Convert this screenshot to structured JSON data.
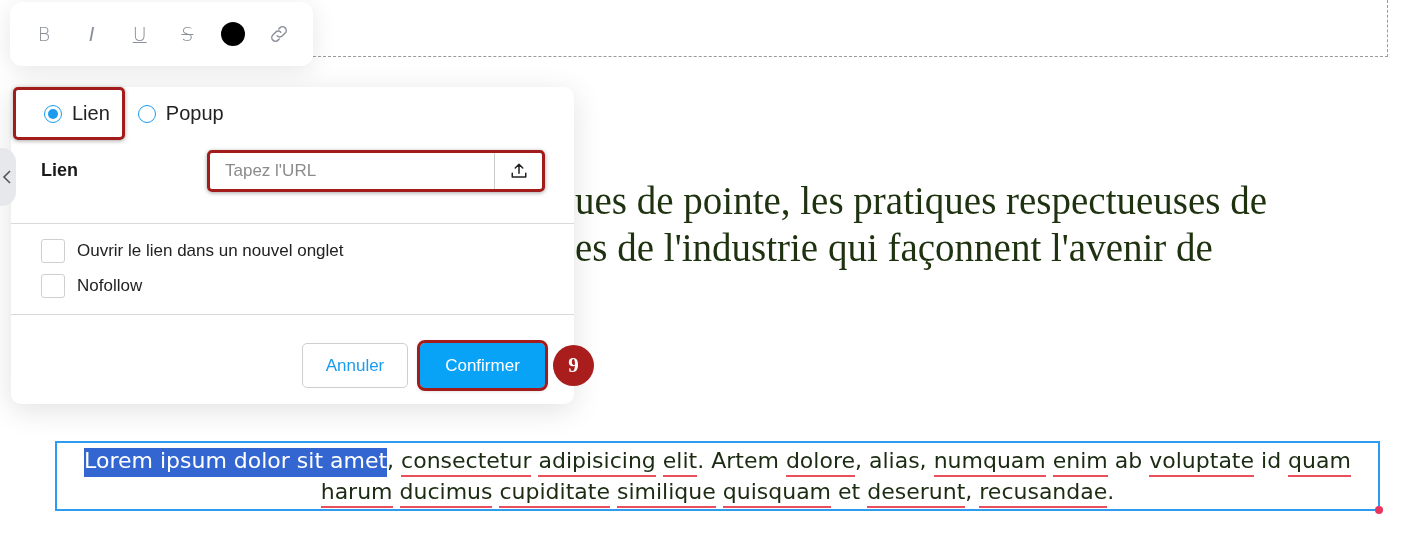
{
  "toolbar": [
    {
      "kind": "bold",
      "glyph": "B"
    },
    {
      "kind": "italic",
      "glyph": "I"
    },
    {
      "kind": "underline",
      "glyph": "U"
    },
    {
      "kind": "strike",
      "glyph": "S"
    },
    {
      "kind": "color",
      "color": "#000000"
    },
    {
      "kind": "link"
    }
  ],
  "link_dialog": {
    "type_options": [
      {
        "label": "Lien",
        "selected": true,
        "highlighted": true
      },
      {
        "label": "Popup",
        "selected": false,
        "highlighted": false
      }
    ],
    "url_field": {
      "label": "Lien",
      "placeholder": "Tapez l'URL",
      "highlighted": true
    },
    "options": [
      {
        "label": "Ouvrir le lien dans un nouvel onglet",
        "checked": false
      },
      {
        "label": "Nofollow",
        "checked": false
      }
    ],
    "buttons": [
      {
        "kind": "secondary",
        "label": "Annuler",
        "highlighted": false
      },
      {
        "kind": "primary",
        "label": "Confirmer",
        "highlighted": true,
        "step_badge": "9"
      }
    ]
  },
  "heading_lines": [
    "ues de pointe, les pratiques respectueuses de",
    "es de l'industrie qui façonnent l'avenir de"
  ],
  "paragraph": {
    "segments": [
      {
        "text": "Lorem ipsum dolor sit amet",
        "selected": true,
        "misspelled": false
      },
      {
        "text": ", ",
        "selected": false,
        "misspelled": false
      },
      {
        "text": "consectetur ",
        "selected": false,
        "misspelled": true
      },
      {
        "text": "adipisicing ",
        "selected": false,
        "misspelled": true
      },
      {
        "text": "elit",
        "selected": false,
        "misspelled": true
      },
      {
        "text": ". Artem ",
        "selected": false,
        "misspelled": false
      },
      {
        "text": "dolore",
        "selected": false,
        "misspelled": true
      },
      {
        "text": ", alias, ",
        "selected": false,
        "misspelled": false
      },
      {
        "text": "numquam ",
        "selected": false,
        "misspelled": true
      },
      {
        "text": "enim",
        "selected": false,
        "misspelled": true
      },
      {
        "text": " ab ",
        "selected": false,
        "misspelled": false
      },
      {
        "text": "voluptate",
        "selected": false,
        "misspelled": true
      },
      {
        "text": " id ",
        "selected": false,
        "misspelled": false
      },
      {
        "text": "quam ",
        "selected": false,
        "misspelled": true
      },
      {
        "text": "harum ",
        "selected": false,
        "misspelled": true
      },
      {
        "text": "ducimus ",
        "selected": false,
        "misspelled": true
      },
      {
        "text": "cupiditate ",
        "selected": false,
        "misspelled": true
      },
      {
        "text": "similique ",
        "selected": false,
        "misspelled": true
      },
      {
        "text": "quisquam",
        "selected": false,
        "misspelled": true
      },
      {
        "text": " et ",
        "selected": false,
        "misspelled": false
      },
      {
        "text": "deserunt",
        "selected": false,
        "misspelled": true
      },
      {
        "text": ", ",
        "selected": false,
        "misspelled": false
      },
      {
        "text": "recusandae",
        "selected": false,
        "misspelled": true
      },
      {
        "text": ".",
        "selected": false,
        "misspelled": false
      }
    ]
  }
}
